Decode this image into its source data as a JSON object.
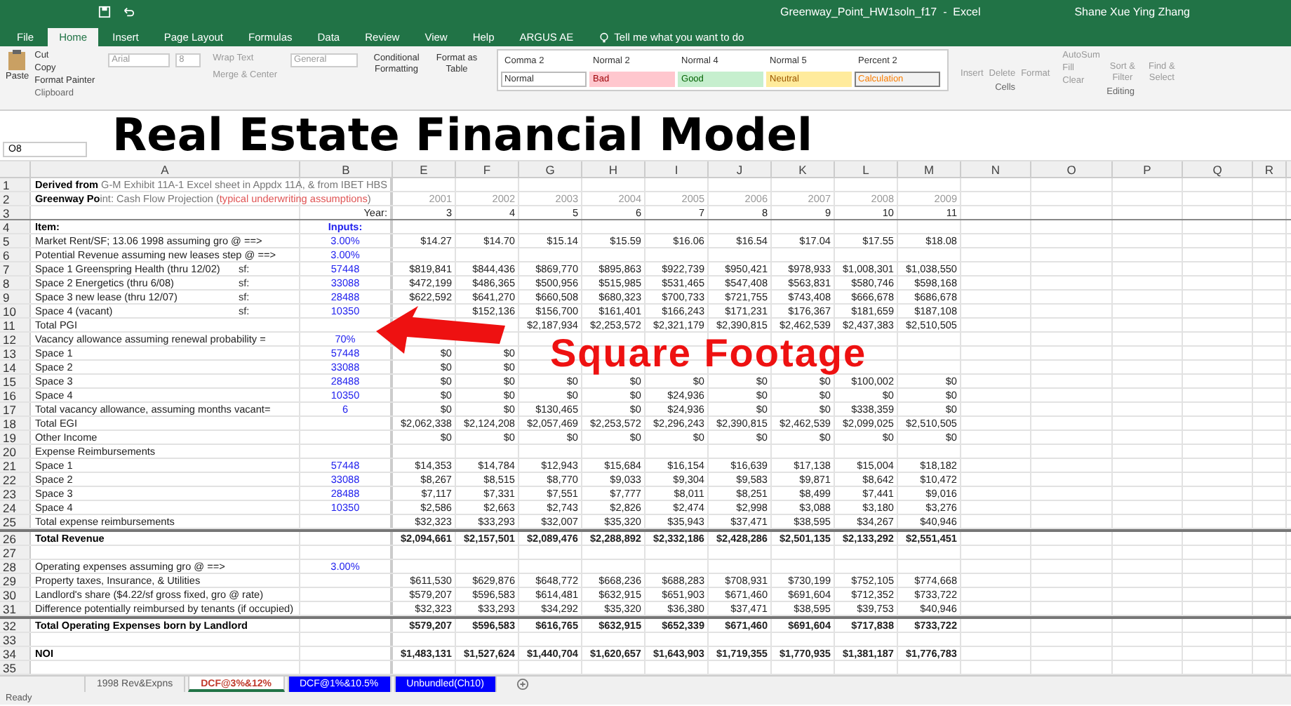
{
  "window": {
    "title": "Greenway_Point_HW1soln_f17  -  Excel",
    "user": "Shane Xue Ying Zhang"
  },
  "ribbon_tabs": [
    {
      "label": "File",
      "selected": false
    },
    {
      "label": "Home",
      "selected": true
    },
    {
      "label": "Insert",
      "selected": false
    },
    {
      "label": "Page Layout",
      "selected": false
    },
    {
      "label": "Formulas",
      "selected": false
    },
    {
      "label": "Data",
      "selected": false
    },
    {
      "label": "Review",
      "selected": false
    },
    {
      "label": "View",
      "selected": false
    },
    {
      "label": "Help",
      "selected": false
    },
    {
      "label": "ARGUS AE",
      "selected": false
    }
  ],
  "tell_me": {
    "placeholder": "Tell me what you want to do"
  },
  "clipboard": {
    "paste": "Paste",
    "items": [
      "Cut",
      "Copy",
      "Format Painter"
    ],
    "group": "Clipboard"
  },
  "font": {
    "name": "Arial",
    "size": "8"
  },
  "alignment": {
    "wrap": "Wrap Text",
    "merge": "Merge & Center"
  },
  "number": {
    "format": "General"
  },
  "styles_buttons": [
    "Conditional Formatting",
    "Format as Table"
  ],
  "styles": [
    {
      "label": "Comma 2",
      "kind": "plain"
    },
    {
      "label": "Normal 2",
      "kind": "plain"
    },
    {
      "label": "Normal 4",
      "kind": "plain"
    },
    {
      "label": "Normal 5",
      "kind": "plain"
    },
    {
      "label": "Percent 2",
      "kind": "plain"
    },
    {
      "label": "Normal",
      "kind": "normal"
    },
    {
      "label": "Bad",
      "kind": "bad"
    },
    {
      "label": "Good",
      "kind": "good"
    },
    {
      "label": "Neutral",
      "kind": "neutral"
    },
    {
      "label": "Calculation",
      "kind": "calc"
    }
  ],
  "cells": {
    "buttons": [
      "Insert",
      "Delete",
      "Format"
    ],
    "group": "Cells"
  },
  "editing": {
    "items": [
      "AutoSum",
      "Fill",
      "Clear"
    ],
    "buttons": [
      "Sort & Filter",
      "Find & Select"
    ],
    "group": "Editing"
  },
  "name_box": "O8",
  "overlay_title": "Real Estate Financial Model",
  "overlay_callout": "Square Footage",
  "columns": [
    "A",
    "B",
    "E",
    "F",
    "G",
    "H",
    "I",
    "J",
    "K",
    "L",
    "M",
    "N",
    "O",
    "P",
    "Q",
    "R"
  ],
  "rows": [
    {
      "n": "1",
      "a": [
        {
          "text": "Derived from ",
          "kind": "bold"
        },
        {
          "text": "G-M Exhibit 11A-1 Excel sheet in Appdx 11A, & from IBET HBS",
          "kind": "grey"
        }
      ]
    },
    {
      "n": "2",
      "a": [
        {
          "text": "Greenway Po",
          "kind": "bold"
        },
        {
          "text": "int: Cash Flow Projection (",
          "kind": "grey"
        },
        {
          "text": "typical underwriting assumptions",
          "kind": "red"
        },
        {
          "text": ")",
          "kind": "grey"
        }
      ],
      "kind": "years",
      "e": "2001",
      "f": "2002",
      "g": "2003",
      "h": "2004",
      "i": "2005",
      "j": "2006",
      "k": "2007",
      "l": "2008",
      "m": "2009"
    },
    {
      "n": "3",
      "year_label": "Year:",
      "kind": "header_end",
      "e": "3",
      "f": "4",
      "g": "5",
      "h": "6",
      "i": "7",
      "j": "8",
      "k": "9",
      "l": "10",
      "m": "11"
    },
    {
      "n": "4",
      "a": [
        {
          "text": "Item:",
          "kind": "bold"
        }
      ],
      "b": "Inputs:",
      "bold_b": true
    },
    {
      "n": "5",
      "a": [
        {
          "text": "Market Rent/SF; 13.06 1998 assuming gro @ ==>",
          "kind": "plain"
        }
      ],
      "b": "3.00%",
      "e": "$14.27",
      "f": "$14.70",
      "g": "$15.14",
      "h": "$15.59",
      "i": "$16.06",
      "j": "$16.54",
      "k": "$17.04",
      "l": "$17.55",
      "m": "$18.08"
    },
    {
      "n": "6",
      "a": [
        {
          "text": "Potential Revenue assuming new leases step @ ==>",
          "kind": "plain"
        }
      ],
      "b": "3.00%"
    },
    {
      "n": "7",
      "a": [
        {
          "text": "Space 1 Greenspring Health (thru 12/02)",
          "kind": "plain"
        }
      ],
      "sf": "sf:",
      "b": "57448",
      "e": "$819,841",
      "f": "$844,436",
      "g": "$869,770",
      "h": "$895,863",
      "i": "$922,739",
      "j": "$950,421",
      "k": "$978,933",
      "l": "$1,008,301",
      "m": "$1,038,550"
    },
    {
      "n": "8",
      "a": [
        {
          "text": "Space 2 Energetics (thru 6/08)",
          "kind": "plain"
        }
      ],
      "sf": "sf:",
      "b": "33088",
      "e": "$472,199",
      "f": "$486,365",
      "g": "$500,956",
      "h": "$515,985",
      "i": "$531,465",
      "j": "$547,408",
      "k": "$563,831",
      "l": "$580,746",
      "m": "$598,168"
    },
    {
      "n": "9",
      "a": [
        {
          "text": "Space 3 new lease (thru 12/07)",
          "kind": "plain"
        }
      ],
      "sf": "sf:",
      "b": "28488",
      "e": "$622,592",
      "f": "$641,270",
      "g": "$660,508",
      "h": "$680,323",
      "i": "$700,733",
      "j": "$721,755",
      "k": "$743,408",
      "l": "$666,678",
      "m": "$686,678"
    },
    {
      "n": "10",
      "a": [
        {
          "text": "Space 4 (vacant)",
          "kind": "plain"
        }
      ],
      "sf": "sf:",
      "b": "10350",
      "f": "$152,136",
      "g": "$156,700",
      "h": "$161,401",
      "i": "$166,243",
      "j": "$171,231",
      "k": "$176,367",
      "l": "$181,659",
      "m": "$187,108"
    },
    {
      "n": "11",
      "a": [
        {
          "text": "Total PGI",
          "kind": "plain"
        }
      ],
      "g": "$2,187,934",
      "h": "$2,253,572",
      "i": "$2,321,179",
      "j": "$2,390,815",
      "k": "$2,462,539",
      "l": "$2,437,383",
      "m": "$2,510,505"
    },
    {
      "n": "12",
      "a": [
        {
          "text": "Vacancy allowance assuming renewal probability =",
          "kind": "plain"
        }
      ],
      "b": "70%"
    },
    {
      "n": "13",
      "a": [
        {
          "text": "Space 1",
          "kind": "plain"
        }
      ],
      "b": "57448",
      "e": "$0",
      "f": "$0"
    },
    {
      "n": "14",
      "a": [
        {
          "text": "Space 2",
          "kind": "plain"
        }
      ],
      "b": "33088",
      "e": "$0",
      "f": "$0"
    },
    {
      "n": "15",
      "a": [
        {
          "text": "Space 3",
          "kind": "plain"
        }
      ],
      "b": "28488",
      "e": "$0",
      "f": "$0",
      "g": "$0",
      "h": "$0",
      "i": "$0",
      "j": "$0",
      "k": "$0",
      "l": "$100,002",
      "m": "$0"
    },
    {
      "n": "16",
      "a": [
        {
          "text": "Space 4",
          "kind": "plain"
        }
      ],
      "b": "10350",
      "e": "$0",
      "f": "$0",
      "g": "$0",
      "h": "$0",
      "i": "$24,936",
      "j": "$0",
      "k": "$0",
      "l": "$0",
      "m": "$0"
    },
    {
      "n": "17",
      "a": [
        {
          "text": "Total vacancy allowance, assuming months vacant=",
          "kind": "plain"
        }
      ],
      "b": "6",
      "e": "$0",
      "f": "$0",
      "g": "$130,465",
      "h": "$0",
      "i": "$24,936",
      "j": "$0",
      "k": "$0",
      "l": "$338,359",
      "m": "$0"
    },
    {
      "n": "18",
      "a": [
        {
          "text": "Total EGI",
          "kind": "plain"
        }
      ],
      "e": "$2,062,338",
      "f": "$2,124,208",
      "g": "$2,057,469",
      "h": "$2,253,572",
      "i": "$2,296,243",
      "j": "$2,390,815",
      "k": "$2,462,539",
      "l": "$2,099,025",
      "m": "$2,510,505"
    },
    {
      "n": "19",
      "a": [
        {
          "text": "Other Income",
          "kind": "plain"
        }
      ],
      "e": "$0",
      "f": "$0",
      "g": "$0",
      "h": "$0",
      "i": "$0",
      "j": "$0",
      "k": "$0",
      "l": "$0",
      "m": "$0"
    },
    {
      "n": "20",
      "a": [
        {
          "text": "Expense Reimbursements",
          "kind": "plain"
        }
      ]
    },
    {
      "n": "21",
      "a": [
        {
          "text": "Space 1",
          "kind": "plain"
        }
      ],
      "b": "57448",
      "e": "$14,353",
      "f": "$14,784",
      "g": "$12,943",
      "h": "$15,684",
      "i": "$16,154",
      "j": "$16,639",
      "k": "$17,138",
      "l": "$15,004",
      "m": "$18,182"
    },
    {
      "n": "22",
      "a": [
        {
          "text": "Space 2",
          "kind": "plain"
        }
      ],
      "b": "33088",
      "e": "$8,267",
      "f": "$8,515",
      "g": "$8,770",
      "h": "$9,033",
      "i": "$9,304",
      "j": "$9,583",
      "k": "$9,871",
      "l": "$8,642",
      "m": "$10,472"
    },
    {
      "n": "23",
      "a": [
        {
          "text": "Space 3",
          "kind": "plain"
        }
      ],
      "b": "28488",
      "e": "$7,117",
      "f": "$7,331",
      "g": "$7,551",
      "h": "$7,777",
      "i": "$8,011",
      "j": "$8,251",
      "k": "$8,499",
      "l": "$7,441",
      "m": "$9,016"
    },
    {
      "n": "24",
      "a": [
        {
          "text": "Space 4",
          "kind": "plain"
        }
      ],
      "b": "10350",
      "e": "$2,586",
      "f": "$2,663",
      "g": "$2,743",
      "h": "$2,826",
      "i": "$2,474",
      "j": "$2,998",
      "k": "$3,088",
      "l": "$3,180",
      "m": "$3,276"
    },
    {
      "n": "25",
      "a": [
        {
          "text": "Total expense reimbursements",
          "kind": "plain"
        }
      ],
      "e": "$32,323",
      "f": "$33,293",
      "g": "$32,007",
      "h": "$35,320",
      "i": "$35,943",
      "j": "$37,471",
      "k": "$38,595",
      "l": "$34,267",
      "m": "$40,946"
    },
    {
      "n": "26",
      "a": [
        {
          "text": "Total Revenue",
          "kind": "bold"
        }
      ],
      "kind": "total",
      "e": "$2,094,661",
      "f": "$2,157,501",
      "g": "$2,089,476",
      "h": "$2,288,892",
      "i": "$2,332,186",
      "j": "$2,428,286",
      "k": "$2,501,135",
      "l": "$2,133,292",
      "m": "$2,551,451"
    },
    {
      "n": "27"
    },
    {
      "n": "28",
      "a": [
        {
          "text": "Operating expenses assuming gro @ ==>",
          "kind": "plain"
        }
      ],
      "b": "3.00%"
    },
    {
      "n": "29",
      "a": [
        {
          "text": "Property taxes, Insurance, & Utilities",
          "kind": "plain"
        }
      ],
      "e": "$611,530",
      "f": "$629,876",
      "g": "$648,772",
      "h": "$668,236",
      "i": "$688,283",
      "j": "$708,931",
      "k": "$730,199",
      "l": "$752,105",
      "m": "$774,668"
    },
    {
      "n": "30",
      "a": [
        {
          "text": "Landlord's share ($4.22/sf gross fixed, gro @ rate)",
          "kind": "plain"
        }
      ],
      "e": "$579,207",
      "f": "$596,583",
      "g": "$614,481",
      "h": "$632,915",
      "i": "$651,903",
      "j": "$671,460",
      "k": "$691,604",
      "l": "$712,352",
      "m": "$733,722"
    },
    {
      "n": "31",
      "a": [
        {
          "text": "Difference potentially reimbursed by tenants (if occupied)",
          "kind": "plain"
        }
      ],
      "e": "$32,323",
      "f": "$33,293",
      "g": "$34,292",
      "h": "$35,320",
      "i": "$36,380",
      "j": "$37,471",
      "k": "$38,595",
      "l": "$39,753",
      "m": "$40,946"
    },
    {
      "n": "32",
      "a": [
        {
          "text": "Total Operating Expenses born by Landlord",
          "kind": "bold"
        }
      ],
      "kind": "total",
      "e": "$579,207",
      "f": "$596,583",
      "g": "$616,765",
      "h": "$632,915",
      "i": "$652,339",
      "j": "$671,460",
      "k": "$691,604",
      "l": "$717,838",
      "m": "$733,722"
    },
    {
      "n": "33"
    },
    {
      "n": "34",
      "a": [
        {
          "text": "NOI",
          "kind": "bold"
        }
      ],
      "kind": "bold_values",
      "e": "$1,483,131",
      "f": "$1,527,624",
      "g": "$1,440,704",
      "h": "$1,620,657",
      "i": "$1,643,903",
      "j": "$1,719,355",
      "k": "$1,770,935",
      "l": "$1,381,187",
      "m": "$1,776,783"
    },
    {
      "n": "35"
    }
  ],
  "sheet_tabs": [
    {
      "label": "1998 Rev&Expns",
      "selected": false
    },
    {
      "label": "DCF@3%&12%",
      "selected": true
    },
    {
      "label": "DCF@1%&10.5%",
      "selected": false,
      "color": "#0000ff"
    },
    {
      "label": "Unbundled(Ch10)",
      "selected": false,
      "color": "#0000ff"
    }
  ],
  "status": "Ready"
}
